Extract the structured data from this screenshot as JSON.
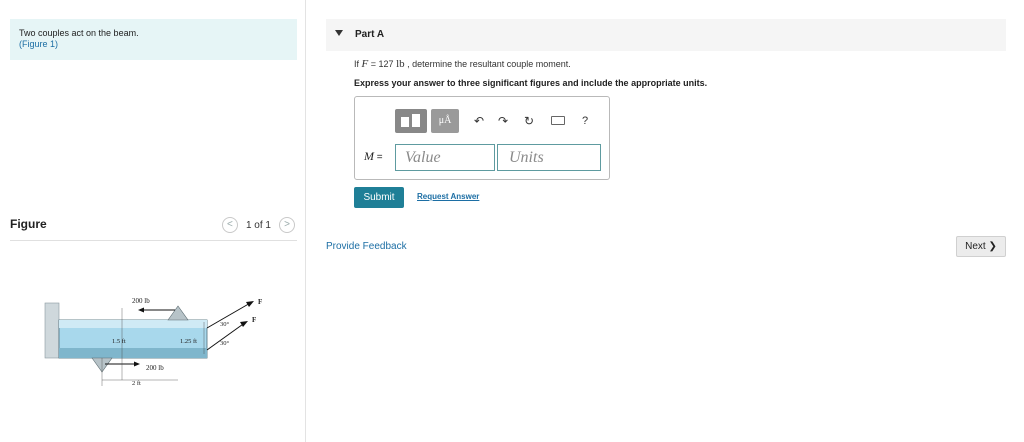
{
  "problem": {
    "text": "Two couples act on the beam.",
    "figure_link": "(Figure 1)"
  },
  "figure": {
    "title": "Figure",
    "pager": {
      "prev": "<",
      "count": "1 of 1",
      "next": ">"
    },
    "labels": {
      "force_top": "200 lb",
      "force_bottom": "200 lb",
      "dim_15": "1.5 ft",
      "dim_125": "1.25 ft",
      "dim_2": "2 ft",
      "angle_top": "30°",
      "angle_bottom": "30°",
      "f_top": "F",
      "f_bottom": "F"
    }
  },
  "part": {
    "title": "Part A",
    "given_prefix": "If",
    "given_var": "F",
    "given_mid": "= 127",
    "given_unit": "lb",
    "given_suffix": ", determine the resultant couple moment.",
    "instruction": "Express your answer to three significant figures and include the appropriate units."
  },
  "toolbar": {
    "mu_label": "μÅ",
    "undo_icon": "↶",
    "redo_icon": "↷",
    "reset_icon": "↻",
    "help_label": "?"
  },
  "answer": {
    "var_label": "M",
    "equals": "=",
    "value_placeholder": "Value",
    "units_placeholder": "Units"
  },
  "actions": {
    "submit": "Submit",
    "request_answer": "Request Answer",
    "feedback": "Provide Feedback",
    "next": "Next ❯"
  }
}
